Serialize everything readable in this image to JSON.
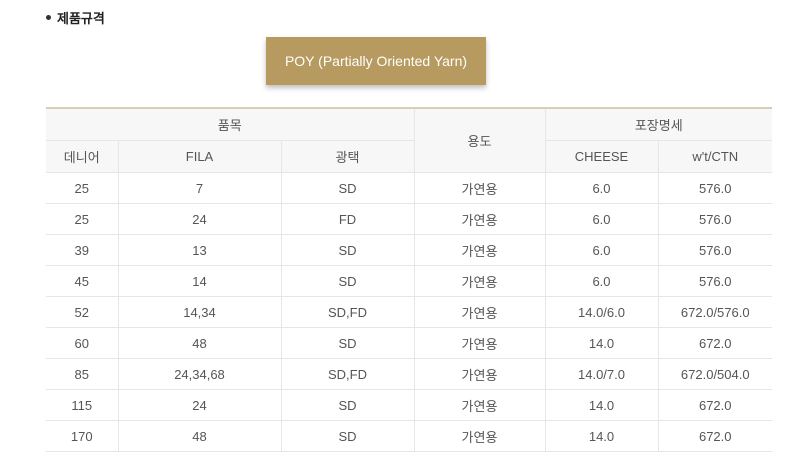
{
  "section": {
    "title": "제품규격"
  },
  "product": {
    "name": "POY (Partially Oriented Yarn)"
  },
  "colors": {
    "accent": "#b79a5f",
    "border_top": "#d9cdb8",
    "header_bg": "#f7f7f7"
  },
  "table": {
    "group_headers": {
      "item": "품목",
      "usage": "용도",
      "packing": "포장명세"
    },
    "sub_headers": {
      "denier": "데니어",
      "fila": "FILA",
      "luster": "광택",
      "cheese": "CHEESE",
      "wt_ctn": "w't/CTN"
    },
    "rows": [
      [
        "25",
        "7",
        "SD",
        "가연용",
        "6.0",
        "576.0"
      ],
      [
        "25",
        "24",
        "FD",
        "가연용",
        "6.0",
        "576.0"
      ],
      [
        "39",
        "13",
        "SD",
        "가연용",
        "6.0",
        "576.0"
      ],
      [
        "45",
        "14",
        "SD",
        "가연용",
        "6.0",
        "576.0"
      ],
      [
        "52",
        "14,34",
        "SD,FD",
        "가연용",
        "14.0/6.0",
        "672.0/576.0"
      ],
      [
        "60",
        "48",
        "SD",
        "가연용",
        "14.0",
        "672.0"
      ],
      [
        "85",
        "24,34,68",
        "SD,FD",
        "가연용",
        "14.0/7.0",
        "672.0/504.0"
      ],
      [
        "115",
        "24",
        "SD",
        "가연용",
        "14.0",
        "672.0"
      ],
      [
        "170",
        "48",
        "SD",
        "가연용",
        "14.0",
        "672.0"
      ]
    ]
  }
}
